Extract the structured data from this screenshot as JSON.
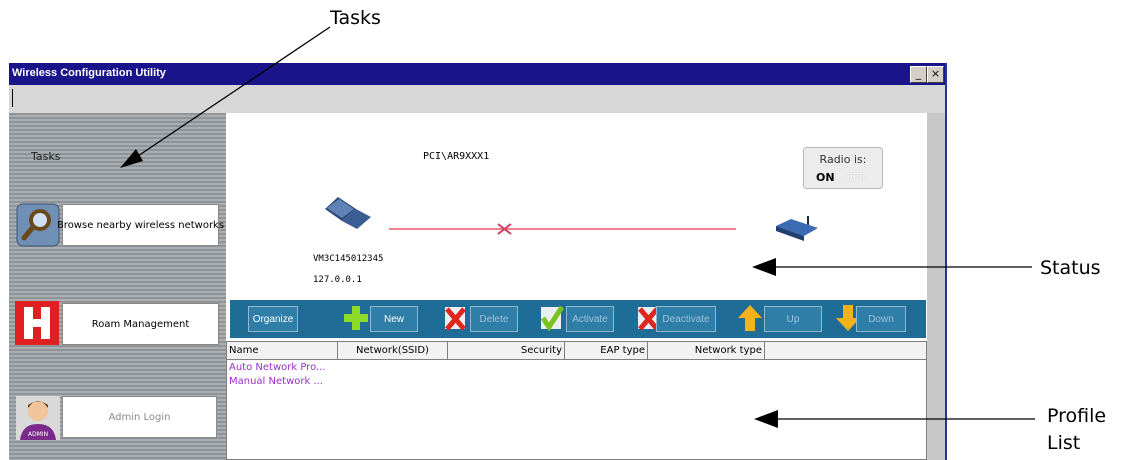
{
  "callouts": {
    "tasks": "Tasks",
    "status": "Status",
    "profile_list_1": "Profile",
    "profile_list_2": "List"
  },
  "window": {
    "title": "Wireless Configuration Utility",
    "minimize": "_",
    "close": "×"
  },
  "sidebar": {
    "heading": "Tasks",
    "items": [
      {
        "label": "Browse nearby wireless networks",
        "icon": "magnifier-icon",
        "enabled": true
      },
      {
        "label": "Roam Management",
        "icon": "roam-h-icon",
        "enabled": true
      },
      {
        "label": "Admin Login",
        "icon": "admin-avatar-icon",
        "icon_text": "ADMIN",
        "enabled": false
      }
    ]
  },
  "status": {
    "adapter": "PCI\\AR9XXX1",
    "radio": {
      "label": "Radio is:",
      "on": "ON",
      "off": "OFF",
      "state": "ON"
    },
    "device": "VM3C145012345",
    "ip": "127.0.0.1",
    "connected": false
  },
  "toolbar": {
    "organize": "Organize",
    "new": "New",
    "delete": "Delete",
    "activate": "Activate",
    "deactivate": "Deactivate",
    "up": "Up",
    "down": "Down"
  },
  "profiles": {
    "columns": [
      "Name",
      "Network(SSID)",
      "Security",
      "EAP type",
      "Network type"
    ],
    "rows": [
      "Auto Network Pro...",
      "Manual Network ..."
    ]
  },
  "colors": {
    "titlebar": "#1a148a",
    "toolbar": "#1f6d97",
    "profile_text": "#9b2fcf",
    "link_line": "#e85a6a"
  }
}
